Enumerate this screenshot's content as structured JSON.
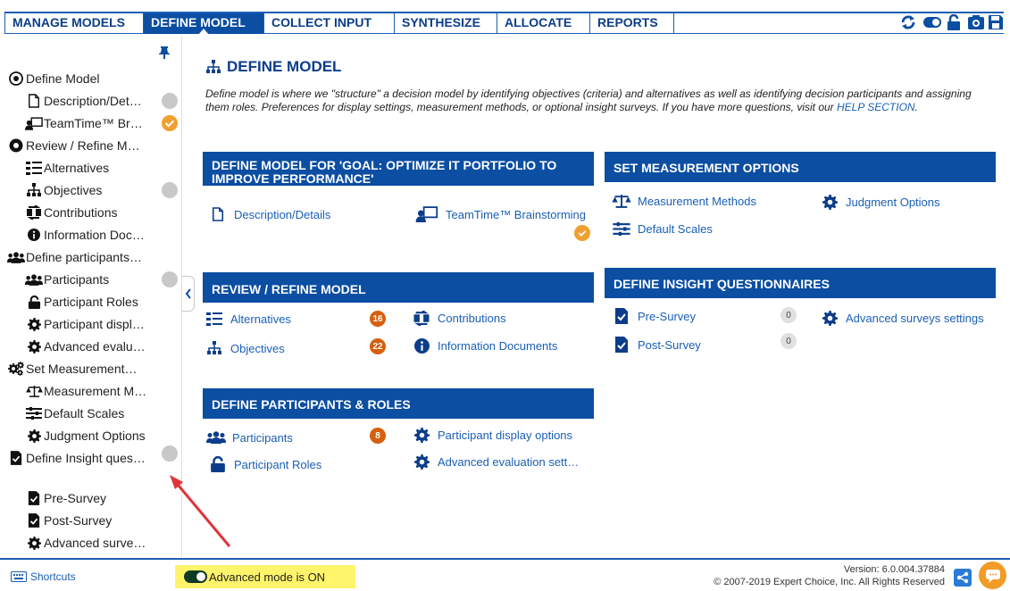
{
  "nav": {
    "tabs": [
      {
        "label": "MANAGE MODELS"
      },
      {
        "label": "DEFINE MODEL"
      },
      {
        "label": "COLLECT INPUT"
      },
      {
        "label": "SYNTHESIZE"
      },
      {
        "label": "ALLOCATE"
      },
      {
        "label": "REPORTS"
      }
    ],
    "active_tab": "DEFINE MODEL",
    "tools": [
      "refresh-icon",
      "toggle-icon",
      "lock-icon",
      "screenshot-icon",
      "save-icon"
    ]
  },
  "sidebar": {
    "items": [
      {
        "label": "Define Model",
        "icon": "target-icon"
      },
      {
        "label": "Description/Det…",
        "icon": "document-icon",
        "status": "grey"
      },
      {
        "label": "TeamTime™ Br…",
        "icon": "teamtime-icon",
        "status": "done"
      },
      {
        "label": "Review / Refine M…",
        "icon": "radio-icon"
      },
      {
        "label": "Alternatives",
        "icon": "alternatives-icon"
      },
      {
        "label": "Objectives",
        "icon": "hierarchy-icon",
        "status": "grey"
      },
      {
        "label": "Contributions",
        "icon": "contributions-icon"
      },
      {
        "label": "Information Doc…",
        "icon": "info-icon"
      },
      {
        "label": "Define participants…",
        "icon": "users-icon"
      },
      {
        "label": "Participants",
        "icon": "users-icon",
        "status": "grey"
      },
      {
        "label": "Participant Roles",
        "icon": "lock-icon"
      },
      {
        "label": "Participant displ…",
        "icon": "gear-icon"
      },
      {
        "label": "Advanced evalu…",
        "icon": "gear-icon"
      },
      {
        "label": "Set Measurement…",
        "icon": "gears-icon"
      },
      {
        "label": "Measurement M…",
        "icon": "scales-icon"
      },
      {
        "label": "Default Scales",
        "icon": "sliders-icon"
      },
      {
        "label": "Judgment Options",
        "icon": "gear-icon",
        "status": "grey"
      },
      {
        "label": "Define Insight ques…",
        "icon": "checkdoc-icon"
      },
      {
        "label": "Pre-Survey",
        "icon": "checkdoc-icon"
      },
      {
        "label": "Post-Survey",
        "icon": "checkdoc-icon"
      },
      {
        "label": "Advanced surve…",
        "icon": "gear-icon"
      }
    ]
  },
  "main": {
    "title": "DEFINE MODEL",
    "intro": "Define model is where we \"structure\" a decision model by identifying objectives (criteria) and alternatives as well as identifying decision participants and assigning them roles. Preferences for display settings, measurement methods, or optional insight surveys. If you have more questions, visit our ",
    "help_link": "HELP SECTION",
    "intro_end": ".",
    "cards": {
      "define": {
        "title": "DEFINE MODEL FOR 'GOAL: OPTIMIZE IT PORTFOLIO TO IMPROVE PERFORMANCE'",
        "links": [
          "Description/Details",
          "TeamTime™ Brainstorming"
        ]
      },
      "review": {
        "title": "REVIEW / REFINE MODEL",
        "links": [
          "Alternatives",
          "Objectives",
          "Contributions",
          "Information Documents"
        ],
        "badges": {
          "alternatives": "16",
          "objectives": "22"
        }
      },
      "participants": {
        "title": "DEFINE PARTICIPANTS & ROLES",
        "links": [
          "Participants",
          "Participant Roles",
          "Participant display options",
          "Advanced evaluation sett…"
        ],
        "badges": {
          "participants": "8"
        }
      },
      "measure": {
        "title": "SET MEASUREMENT OPTIONS",
        "links": [
          "Measurement Methods",
          "Judgment Options",
          "Default Scales"
        ]
      },
      "insight": {
        "title": "DEFINE INSIGHT QUESTIONNAIRES",
        "links": [
          "Pre-Survey",
          "Post-Survey",
          "Advanced surveys settings"
        ],
        "badges": {
          "pre": "0",
          "post": "0"
        }
      }
    }
  },
  "footer": {
    "shortcuts": "Shortcuts",
    "advanced_mode": "Advanced mode is ON",
    "version": "Version: 6.0.004.37884",
    "copyright": "© 2007-2019 Expert Choice, Inc. All Rights Reserved"
  },
  "colors": {
    "nav_blue": "#0b4ea2",
    "link_blue": "#1a5fb4",
    "badge_orange": "#d4600f",
    "done_orange": "#f0a030",
    "highlight": "#fff46a",
    "arrow_red": "#e0343a"
  }
}
